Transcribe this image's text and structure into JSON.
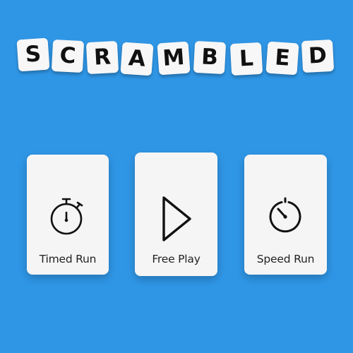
{
  "colors": {
    "background": "#2f96e6",
    "tile": "#f7f7f7",
    "tile_letter": "#111111",
    "card": "#f5f5f5",
    "icon": "#111111"
  },
  "title": {
    "letters": [
      "S",
      "C",
      "R",
      "A",
      "M",
      "B",
      "L",
      "E",
      "D"
    ]
  },
  "modes": [
    {
      "label": "Timed Run",
      "icon": "stopwatch-icon"
    },
    {
      "label": "Free Play",
      "icon": "play-icon"
    },
    {
      "label": "Speed Run",
      "icon": "speed-timer-icon"
    }
  ]
}
